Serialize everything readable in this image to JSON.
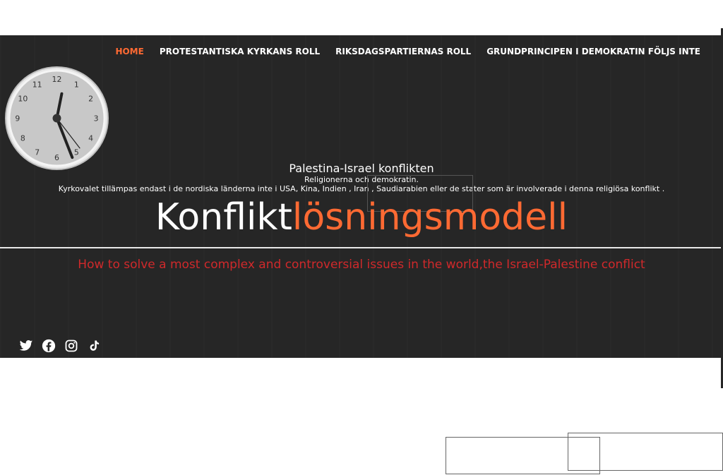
{
  "nav": {
    "items": [
      {
        "label": "HOME",
        "active": true
      },
      {
        "label": "PROTESTANTISKA KYRKANS ROLL",
        "active": false
      },
      {
        "label": "RIKSDAGSPARTIERNAS ROLL",
        "active": false
      },
      {
        "label": "GRUNDPRINCIPEN I DEMOKRATIN FÖLJS INTE",
        "active": false
      }
    ]
  },
  "clock": {
    "numbers": [
      "12",
      "1",
      "2",
      "3",
      "4",
      "5",
      "6",
      "7",
      "8",
      "9",
      "10",
      "11"
    ],
    "time": "12:25"
  },
  "header": {
    "title": "Palestina-Israel konflikten",
    "subtitle": "Religionerna och demokratin.",
    "description": "Kyrkovalet tillämpas endast i de nordiska länderna inte i USA, Kina, Indien , Iran , Saudiarabien eller de stater som är involverade i denna religiösa konflikt ."
  },
  "hero": {
    "title_white": "Konflikt",
    "title_orange": "lösningsmodell",
    "tagline": "How to solve a most complex and controversial issues in the world,the Israel-Palestine conflict"
  },
  "social": {
    "icons": [
      "twitter-icon",
      "facebook-icon",
      "instagram-icon",
      "tiktok-icon"
    ]
  },
  "colors": {
    "accent": "#ff6a33",
    "tagline": "#d0292b",
    "background": "#262626"
  }
}
